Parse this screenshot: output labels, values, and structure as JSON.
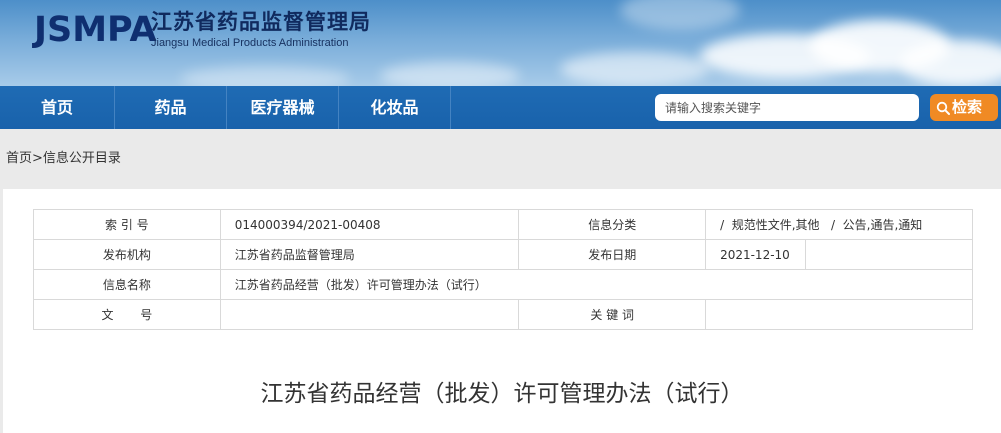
{
  "header": {
    "logo_abbr": "JSMPA",
    "org_name_cn": "江苏省药品监督管理局",
    "org_name_en": "Jiangsu Medical Products Administration",
    "top_links": [
      "",
      "",
      ""
    ]
  },
  "nav": {
    "items": [
      "首页",
      "药品",
      "医疗器械",
      "化妆品"
    ],
    "search_placeholder": "请输入搜索关键字",
    "search_button": "检索",
    "accent_color": "#1f6bb4",
    "button_color": "#f08a24"
  },
  "breadcrumb": {
    "home": "首页",
    "separator": ">",
    "current": "信息公开目录"
  },
  "meta": {
    "index_label": "索 引 号",
    "index_value": "014000394/2021-00408",
    "category_label": "信息分类",
    "category_value": "/  规范性文件,其他   /  公告,通告,通知",
    "publisher_label": "发布机构",
    "publisher_value": "江苏省药品监督管理局",
    "date_label": "发布日期",
    "date_value": "2021-12-10",
    "name_label": "信息名称",
    "name_value": "江苏省药品经营（批发）许可管理办法（试行）",
    "docno_label": "文       号",
    "docno_value": "",
    "keyword_label": "关 键 词",
    "keyword_value": ""
  },
  "document": {
    "title": "江苏省药品经营（批发）许可管理办法（试行）"
  }
}
